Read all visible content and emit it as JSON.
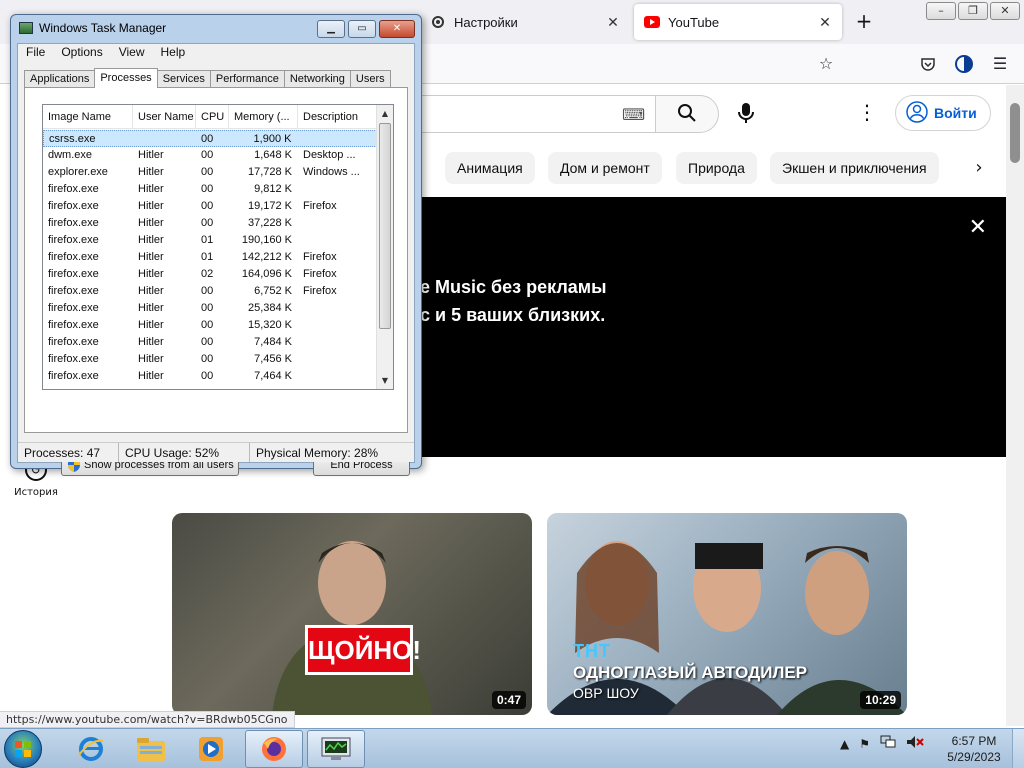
{
  "browser": {
    "tabs": [
      {
        "label": "Настройки",
        "icon": "gear-icon"
      },
      {
        "label": "YouTube",
        "icon": "youtube-icon"
      }
    ],
    "window_controls": {
      "minimize": "–",
      "maximize": "❐",
      "close": "✕"
    }
  },
  "youtube": {
    "signin_label": "Войти",
    "chips": [
      "Анимация",
      "Дом и ремонт",
      "Природа",
      "Экшен и приключения"
    ],
    "banner": {
      "line1": "e Music без рекламы",
      "line2": "с и 5 ваших близких."
    },
    "sidebar": {
      "history_label": "История"
    },
    "videos": [
      {
        "duration": "0:47",
        "thumb_text": "ЩОЙНО!"
      },
      {
        "duration": "10:29",
        "logo_text": "ТНТ",
        "caption": "ОДНОГЛАЗЫЙ АВТОДИЛЕР",
        "subcaption": "ОВР ШОУ"
      }
    ],
    "status_url": "https://www.youtube.com/watch?v=BRdwb05CGno"
  },
  "taskmgr": {
    "title": "Windows Task Manager",
    "menu": [
      "File",
      "Options",
      "View",
      "Help"
    ],
    "tabs": [
      "Applications",
      "Processes",
      "Services",
      "Performance",
      "Networking",
      "Users"
    ],
    "active_tab": "Processes",
    "columns": [
      "Image Name",
      "User Name",
      "CPU",
      "Memory (...",
      "Description"
    ],
    "rows": [
      {
        "name": "csrss.exe",
        "user": "",
        "cpu": "00",
        "mem": "1,900 K",
        "desc": ""
      },
      {
        "name": "dwm.exe",
        "user": "Hitler",
        "cpu": "00",
        "mem": "1,648 K",
        "desc": "Desktop ..."
      },
      {
        "name": "explorer.exe",
        "user": "Hitler",
        "cpu": "00",
        "mem": "17,728 K",
        "desc": "Windows ..."
      },
      {
        "name": "firefox.exe",
        "user": "Hitler",
        "cpu": "00",
        "mem": "9,812 K",
        "desc": ""
      },
      {
        "name": "firefox.exe",
        "user": "Hitler",
        "cpu": "00",
        "mem": "19,172 K",
        "desc": "Firefox"
      },
      {
        "name": "firefox.exe",
        "user": "Hitler",
        "cpu": "00",
        "mem": "37,228 K",
        "desc": ""
      },
      {
        "name": "firefox.exe",
        "user": "Hitler",
        "cpu": "01",
        "mem": "190,160 K",
        "desc": ""
      },
      {
        "name": "firefox.exe",
        "user": "Hitler",
        "cpu": "01",
        "mem": "142,212 K",
        "desc": "Firefox"
      },
      {
        "name": "firefox.exe",
        "user": "Hitler",
        "cpu": "02",
        "mem": "164,096 K",
        "desc": "Firefox"
      },
      {
        "name": "firefox.exe",
        "user": "Hitler",
        "cpu": "00",
        "mem": "6,752 K",
        "desc": "Firefox"
      },
      {
        "name": "firefox.exe",
        "user": "Hitler",
        "cpu": "00",
        "mem": "25,384 K",
        "desc": ""
      },
      {
        "name": "firefox.exe",
        "user": "Hitler",
        "cpu": "00",
        "mem": "15,320 K",
        "desc": ""
      },
      {
        "name": "firefox.exe",
        "user": "Hitler",
        "cpu": "00",
        "mem": "7,484 K",
        "desc": ""
      },
      {
        "name": "firefox.exe",
        "user": "Hitler",
        "cpu": "00",
        "mem": "7,456 K",
        "desc": ""
      },
      {
        "name": "firefox.exe",
        "user": "Hitler",
        "cpu": "00",
        "mem": "7,464 K",
        "desc": ""
      }
    ],
    "show_all_label": "Show processes from all users",
    "end_process_label": "End Process",
    "status": {
      "processes": "Processes: 47",
      "cpu": "CPU Usage: 52%",
      "memory": "Physical Memory: 28%"
    }
  },
  "taskbar": {
    "pinned": [
      "ie-icon",
      "explorer-icon",
      "media-player-icon",
      "firefox-icon",
      "task-manager-icon"
    ],
    "clock_time": "6:57 PM",
    "clock_date": "5/29/2023"
  },
  "colors": {
    "youtube_red": "#ff0000",
    "link_blue": "#065fd4",
    "banner_bg": "#000000"
  }
}
